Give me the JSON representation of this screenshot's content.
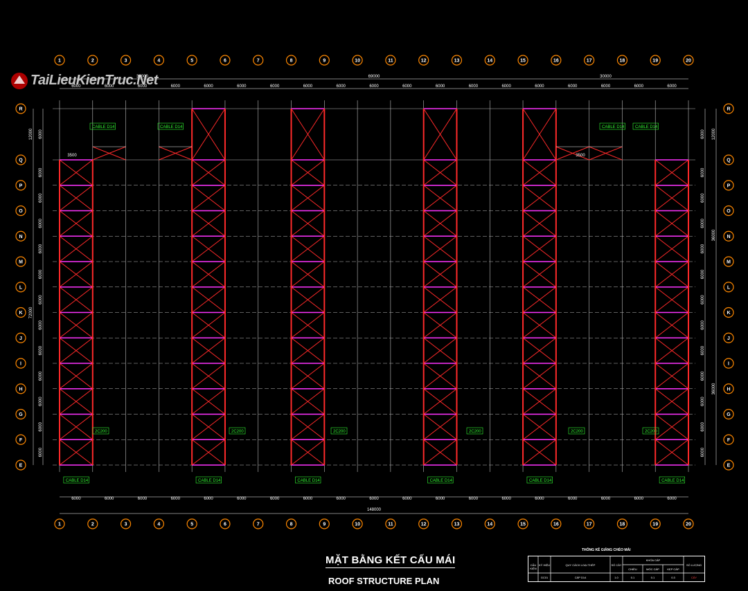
{
  "logo": {
    "text": "TaiLieuKienTruc.Net"
  },
  "grid": {
    "columns": [
      "1",
      "2",
      "3",
      "4",
      "5",
      "6",
      "7",
      "8",
      "9",
      "10",
      "11",
      "12",
      "13",
      "14",
      "15",
      "16",
      "17",
      "18",
      "19",
      "20"
    ],
    "rows_left": [
      "R",
      "Q",
      "P",
      "O",
      "N",
      "M",
      "L",
      "K",
      "J",
      "I",
      "H",
      "G",
      "F",
      "E"
    ],
    "rows_right": [
      "R",
      "Q",
      "P",
      "O",
      "N",
      "M",
      "L",
      "K",
      "J",
      "I",
      "H",
      "G",
      "F",
      "E"
    ]
  },
  "dimensions": {
    "top_segments": [
      "6000",
      "6000",
      "6000",
      "6000",
      "6000",
      "6000",
      "6000",
      "6000",
      "6000",
      "6000",
      "6000",
      "6000",
      "6000",
      "6000",
      "6000",
      "6000",
      "6000",
      "6000",
      "6000"
    ],
    "top_groups": [
      "30000",
      "69000",
      "30000"
    ],
    "bottom_segments": [
      "6000",
      "6000",
      "6000",
      "6000",
      "6000",
      "6000",
      "6000",
      "6000",
      "6000",
      "6000",
      "6000",
      "6000",
      "6000",
      "6000",
      "6000",
      "6000",
      "6000",
      "6000",
      "6000"
    ],
    "bottom_total": "148000",
    "left_total_upper": "12000",
    "left_total": "72000",
    "right_total_upper": "12000",
    "right_total_mid": "36000",
    "right_total_lower": "36000",
    "side_segments": [
      "6000",
      "6000",
      "6000",
      "6000",
      "6000",
      "6000",
      "6000",
      "6000",
      "6000",
      "6000",
      "6000",
      "6000",
      "6000"
    ],
    "offset_left": "3500",
    "offset_right": "3500"
  },
  "labels": {
    "cable_top": "CABLE D14",
    "cable_bottom": "CABLE D14",
    "member": "2C200"
  },
  "titles": {
    "main": "MẶT BẰNG KẾT CẤU MÁI",
    "sub": "ROOF STRUCTURE PLAN"
  },
  "table": {
    "title": "THỐNG KÊ GIẰNG CHÉO MÁI",
    "headers": [
      "CẤU KIỆN",
      "KÝ HIỆU",
      "QUY CÁCH LOẠI THÉP",
      "SỐ CÂY",
      "KHÓA CÁP",
      "SỐ LƯỢNG"
    ],
    "subheaders": [
      "CHIỀU",
      "MÓC CÁP",
      "KẸP CÁP"
    ],
    "row": [
      "GC01",
      "CÁP D14",
      "",
      "1.0",
      "0.1",
      "0.1",
      "0.3",
      "CÂY"
    ]
  },
  "colors": {
    "bracing": "#ff2a2a",
    "purlin": "#ff33ff",
    "grid": "#bfbfbf",
    "bubble": "#ff8800",
    "tag": "#33ff33"
  }
}
